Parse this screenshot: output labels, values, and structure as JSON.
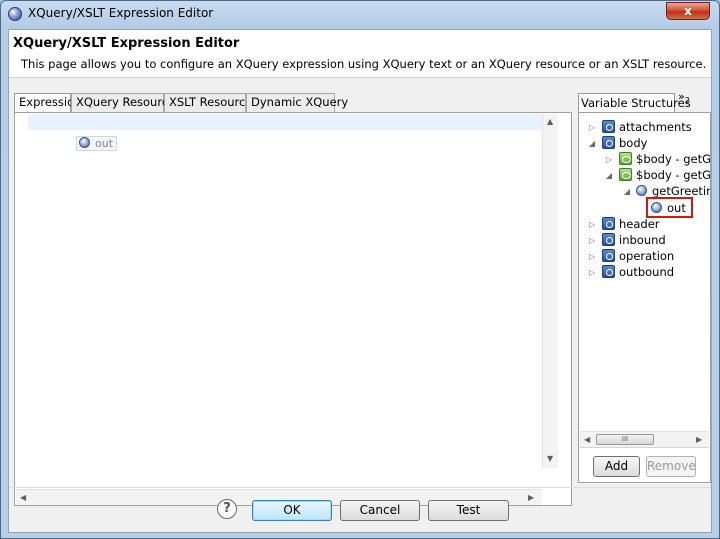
{
  "window": {
    "title": "XQuery/XSLT Expression Editor",
    "close_glyph": "x"
  },
  "header": {
    "title": "XQuery/XSLT Expression Editor",
    "description": "This page allows you to configure an XQuery expression using XQuery text or an XQuery resource or an XSLT resource."
  },
  "tabs": [
    {
      "label": "Expression",
      "active": true
    },
    {
      "label": "XQuery Resources",
      "active": false
    },
    {
      "label": "XSLT Resources",
      "active": false
    },
    {
      "label": "Dynamic XQuery",
      "active": false
    }
  ],
  "editor": {
    "tokens": [
      {
        "label": "out",
        "icon": "element-circle-icon"
      }
    ]
  },
  "variables_panel": {
    "tab_label": "Variable Structures",
    "more_tabs_glyph": "»",
    "more_tabs_count": "2",
    "tree": [
      {
        "label": "attachments",
        "icon": "variable-icon",
        "expanded": false
      },
      {
        "label": "body",
        "icon": "variable-icon",
        "expanded": true
      },
      {
        "label": "$body - getGre",
        "icon": "element-icon",
        "expanded": false
      },
      {
        "label": "$body - getGre",
        "icon": "element-icon",
        "expanded": true
      },
      {
        "label": "getGreeting",
        "icon": "element-circle-icon",
        "expanded": true
      },
      {
        "label": "out",
        "icon": "element-circle-icon",
        "highlighted": true
      },
      {
        "label": "header",
        "icon": "variable-icon",
        "expanded": false
      },
      {
        "label": "inbound",
        "icon": "variable-icon",
        "expanded": false
      },
      {
        "label": "operation",
        "icon": "variable-icon",
        "expanded": false
      },
      {
        "label": "outbound",
        "icon": "variable-icon",
        "expanded": false
      }
    ],
    "scroll_thumb_glyph": "III",
    "add_label": "Add",
    "remove_label": "Remove"
  },
  "footer": {
    "help_glyph": "?",
    "ok_label": "OK",
    "cancel_label": "Cancel",
    "test_label": "Test"
  },
  "colors": {
    "highlight_border": "#d01818",
    "close_button": "#c0301a",
    "default_button": "#3c7fb1"
  }
}
